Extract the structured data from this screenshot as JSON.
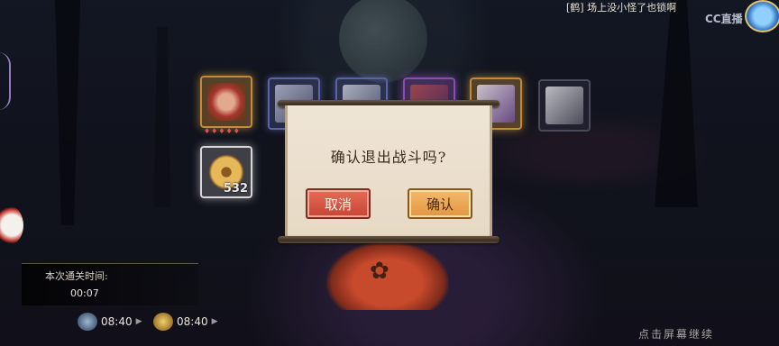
{
  "top_status": {
    "text": "[鹤] 场上没小怪了也锁啊"
  },
  "branding": {
    "cc_logo": "CC直播"
  },
  "reward_slots": [
    {
      "name": "reward-slot-shikigami",
      "icon": "shikigami-portrait-icon",
      "glow": "gold",
      "stars": "♦♦♦♦♦"
    },
    {
      "name": "reward-slot-blue-1",
      "icon": "item-icon",
      "glow": "blue"
    },
    {
      "name": "reward-slot-blue-2",
      "icon": "item-icon",
      "glow": "blue"
    },
    {
      "name": "reward-slot-purple",
      "icon": "item-icon",
      "glow": "purple"
    },
    {
      "name": "reward-slot-gold",
      "icon": "item-icon",
      "glow": "gold"
    },
    {
      "name": "reward-slot-plain",
      "icon": "item-icon",
      "glow": "none"
    },
    {
      "name": "reward-slot-coin",
      "icon": "coin-icon",
      "glow": "white",
      "quantity": "532"
    }
  ],
  "dialog": {
    "title": "确认退出战斗吗?",
    "cancel_label": "取消",
    "confirm_label": "确认"
  },
  "stage_info": {
    "label": "本次通关时间:",
    "time": "00:07"
  },
  "timers": [
    {
      "icon": "ticket-icon",
      "value": "08:40"
    },
    {
      "icon": "coin-ticket-icon",
      "value": "08:40"
    }
  ],
  "continue_hint": "点击屏幕继续",
  "colors": {
    "cancel_button": "#d9574a",
    "confirm_button": "#eaa555",
    "dialog_paper": "#ebe0cd"
  }
}
